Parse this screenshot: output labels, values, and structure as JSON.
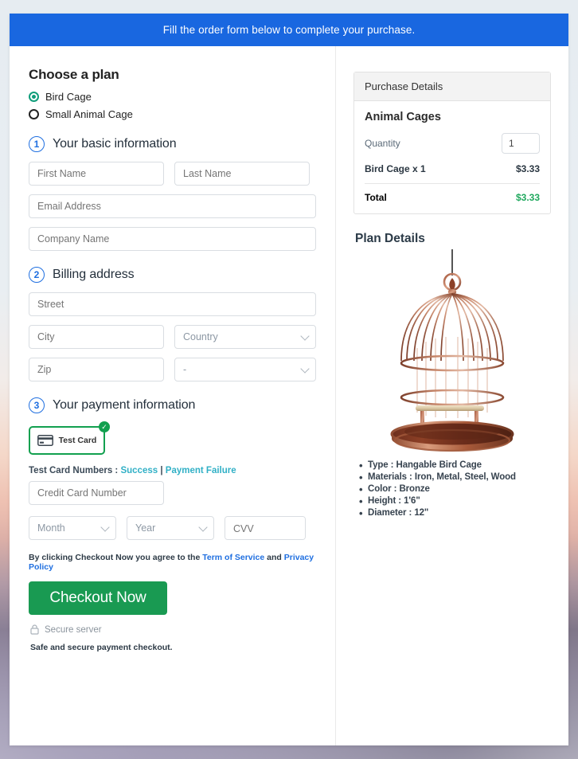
{
  "banner": {
    "text": "Fill the order form below to complete your purchase."
  },
  "plan": {
    "heading": "Choose a plan",
    "options": [
      {
        "label": "Bird Cage",
        "selected": true
      },
      {
        "label": "Small Animal Cage",
        "selected": false
      }
    ]
  },
  "steps": {
    "basic": {
      "num": "1",
      "label": "Your basic information"
    },
    "billing": {
      "num": "2",
      "label": "Billing address"
    },
    "payment": {
      "num": "3",
      "label": "Your payment information"
    }
  },
  "basic_fields": {
    "first_name": "First Name",
    "last_name": "Last Name",
    "email": "Email Address",
    "company": "Company Name"
  },
  "billing_fields": {
    "street": "Street",
    "city": "City",
    "country": "Country",
    "zip": "Zip",
    "state": "-"
  },
  "payment": {
    "method_label": "Test  Card",
    "method_selected_icon": "check-circle-icon",
    "card_icon": "credit-card-icon",
    "test_numbers_prefix": "Test Card Numbers :",
    "test_success": "Success",
    "test_separator": "|",
    "test_failure": "Payment Failure",
    "card_number": "Credit Card Number",
    "month": "Month",
    "year": "Year",
    "cvv": "CVV",
    "cvv_icon": "credit-card-icon"
  },
  "footer": {
    "terms_prefix": "By clicking Checkout Now you agree to the",
    "terms_link": "Term of Service",
    "terms_and": "and",
    "privacy_link": "Privacy Policy",
    "checkout_label": "Checkout Now",
    "secure_icon": "lock-icon",
    "secure_label": "Secure server",
    "safe_note": "Safe and secure payment checkout."
  },
  "purchase": {
    "header": "Purchase Details",
    "product": "Animal Cages",
    "quantity_label": "Quantity",
    "quantity_value": "1",
    "line_item_label": "Bird Cage x 1",
    "line_item_amount": "$3.33",
    "total_label": "Total",
    "total_amount": "$3.33"
  },
  "plan_details": {
    "title": "Plan Details",
    "image_name": "bird-cage-illustration",
    "specs": [
      "Type : Hangable Bird Cage",
      "Materials : Iron, Metal, Steel, Wood",
      "Color : Bronze",
      "Height : 1'6\"",
      "Diameter : 12\""
    ]
  },
  "colors": {
    "banner_blue": "#1967e0",
    "step_blue": "#1f6fe0",
    "radio_green": "#0f9d7a",
    "card_green": "#12a04f",
    "button_green": "#199a52",
    "total_green": "#1fa85d",
    "link_teal": "#31b0c6",
    "link_blue": "#1f6fe0",
    "cage_bronze": "#a85f42"
  }
}
